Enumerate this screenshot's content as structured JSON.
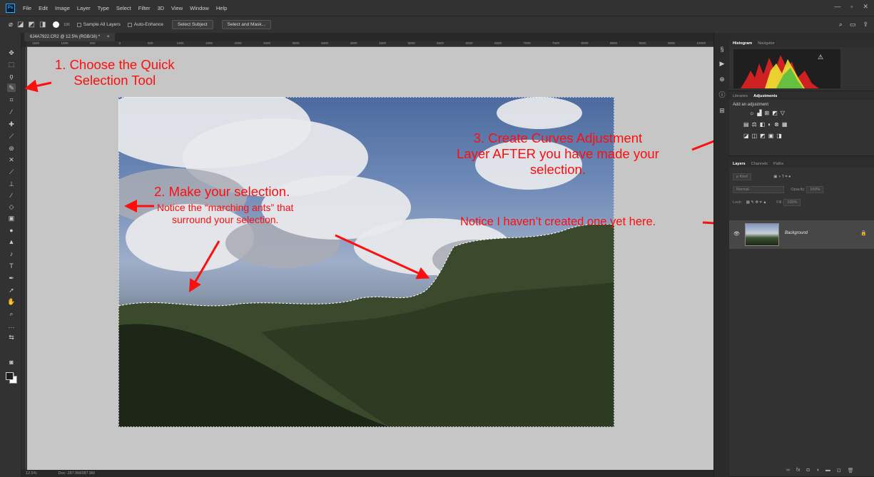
{
  "app": {
    "logo": "Ps"
  },
  "menu": [
    "File",
    "Edit",
    "Image",
    "Layer",
    "Type",
    "Select",
    "Filter",
    "3D",
    "View",
    "Window",
    "Help"
  ],
  "window_controls": [
    "—",
    "▫",
    "✕"
  ],
  "options_bar": {
    "brush_size": "100",
    "sample_all_layers": "Sample All Layers",
    "auto_enhance": "Auto-Enhance",
    "select_subject": "Select Subject",
    "select_and_mask": "Select and Mask..."
  },
  "document": {
    "tab_title": "6J4A7922.CR2 @ 12.5% (RGB/16) *",
    "close": "×"
  },
  "ruler_ticks": [
    "1500",
    "1000",
    "500",
    "0",
    "500",
    "1000",
    "1500",
    "2000",
    "2500",
    "3000",
    "3500",
    "4000",
    "4500",
    "5000",
    "5500",
    "6000",
    "6500",
    "7000",
    "7500",
    "8000",
    "8500",
    "9000",
    "9500",
    "10000"
  ],
  "status": {
    "zoom": "12.5%",
    "doc": "Doc: 287.9M/287.9M"
  },
  "annotations": {
    "step1_line1": "1. Choose the Quick",
    "step1_line2": "Selection Tool",
    "step2_title": "2. Make your selection.",
    "step2_line1": "Notice the “marching ants” that",
    "step2_line2": "surround your selection.",
    "step3_line1": "3. Create Curves Adjustment",
    "step3_line2": "Layer AFTER you have made your",
    "step3_line3": "selection.",
    "step4": "Notice I haven’t created one yet here."
  },
  "panels": {
    "histogram_tabs": [
      "Histogram",
      "Navigator"
    ],
    "adjust_tabs": [
      "Libraries",
      "Adjustments"
    ],
    "add_adjustment": "Add an adjustment",
    "layers_tabs": [
      "Layers",
      "Channels",
      "Paths"
    ],
    "kind_filter": "ρ Kind",
    "blend_mode": "Normal",
    "opacity_label": "Opacity:",
    "opacity_value": "100%",
    "lock_label": "Lock:",
    "fill_label": "Fill:",
    "fill_value": "100%",
    "layer_name": "Background"
  },
  "colors": {
    "annotation": "#ff0e0e",
    "foreground": "#1e1e1e",
    "background_swatch": "#ffffff"
  }
}
